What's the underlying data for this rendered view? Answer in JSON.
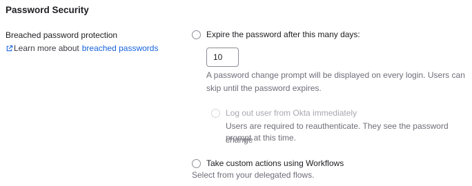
{
  "section": {
    "title": "Password Security"
  },
  "setting": {
    "label": "Breached password protection",
    "learn_more_prefix": "Learn more about",
    "learn_more_link": "breached passwords",
    "learn_more_icon": "external-link-icon"
  },
  "options": {
    "expire": {
      "label": "Expire the password after this many days:",
      "days_value": "10",
      "help_line1": "A password change prompt will be displayed on every login. Users can",
      "help_line2": "skip until the password expires.",
      "selected": false
    },
    "logout": {
      "label": "Log out user from Okta immediately",
      "help_line1": "Users are required to reauthenticate. They see the password change",
      "help_line2": "prompt at this time.",
      "disabled": true,
      "selected": false
    },
    "workflows": {
      "label": "Take custom actions using Workflows",
      "help": "Select from your delegated flows.",
      "selected": false
    }
  },
  "colors": {
    "link": "#1662dd",
    "help_text": "#6e6e78",
    "disabled_text": "#a7a7b0"
  }
}
